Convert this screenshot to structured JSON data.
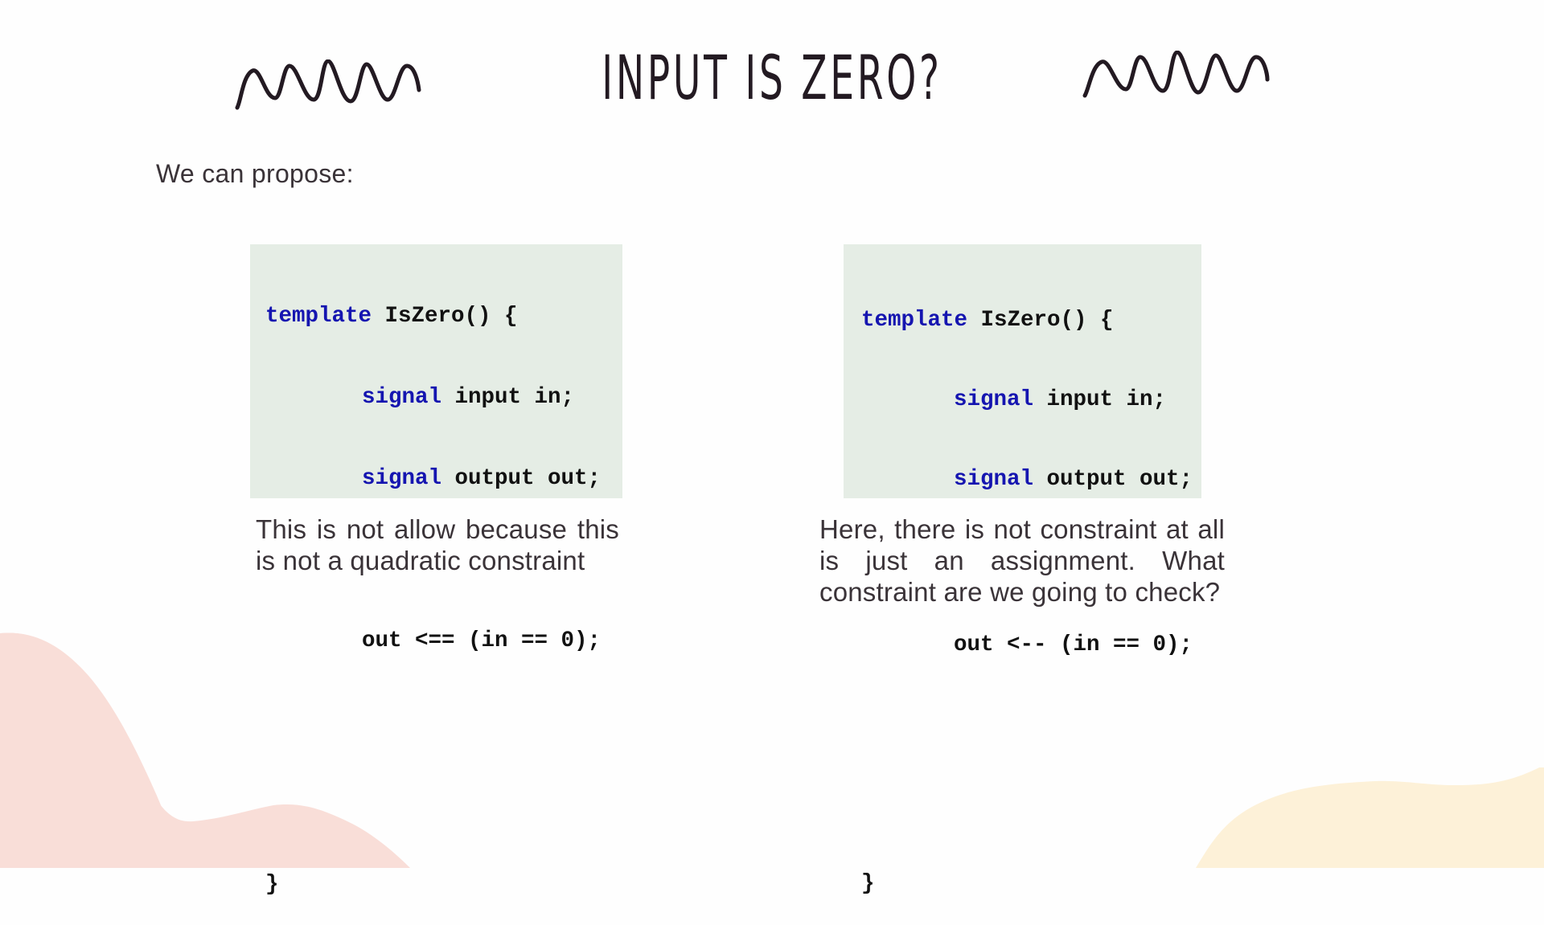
{
  "slide": {
    "title": "INPUT IS ZERO?",
    "intro": "We can propose:",
    "colors": {
      "code_background": "#e5ede5",
      "keyword": "#1515b0",
      "text": "#231a22",
      "blob_left": "#f9ded8",
      "blob_right": "#fdf1d8"
    },
    "decorations": [
      "squiggle-left",
      "squiggle-right",
      "blob-bottom-left",
      "blob-bottom-right"
    ]
  },
  "code_left": {
    "lines": [
      {
        "kw": "template",
        "rest": " IsZero() {"
      },
      {
        "kw": "signal",
        "rest": " input in;"
      },
      {
        "kw": "signal",
        "rest": " output out;"
      },
      {
        "kw": "",
        "rest": ""
      },
      {
        "kw": "",
        "rest": "out <== (in == 0);"
      },
      {
        "kw": "",
        "rest": ""
      },
      {
        "kw": "",
        "rest": ""
      },
      {
        "kw": "",
        "rest": "}"
      }
    ]
  },
  "code_right": {
    "lines": [
      {
        "kw": "template",
        "rest": " IsZero() {"
      },
      {
        "kw": "signal",
        "rest": " input in;"
      },
      {
        "kw": "signal",
        "rest": " output out;"
      },
      {
        "kw": "",
        "rest": ""
      },
      {
        "kw": "",
        "rest": "out <-- (in == 0);"
      },
      {
        "kw": "",
        "rest": ""
      },
      {
        "kw": "",
        "rest": ""
      },
      {
        "kw": "",
        "rest": "}"
      }
    ]
  },
  "captions": {
    "left": "This is not allow because this is not a quadratic constraint",
    "right": "Here, there is not constraint at all is just an assignment. What constraint are we going to check?"
  }
}
